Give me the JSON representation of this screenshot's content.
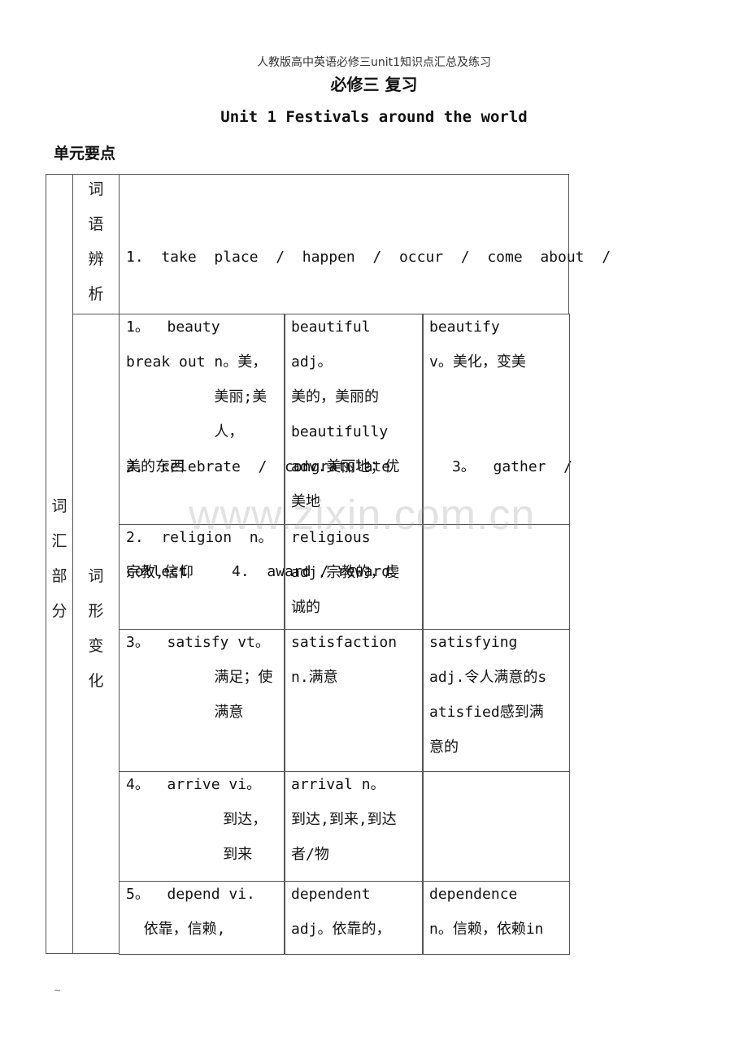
{
  "header": {
    "doc_name": "人教版高中英语必修三unit1知识点汇总及练习",
    "title": "必修三 复习",
    "unit_title": "Unit 1  Festivals around the world",
    "section": "单元要点"
  },
  "table": {
    "category": [
      "词",
      "汇",
      "部",
      "分"
    ],
    "word_discrimination": {
      "label": [
        "词",
        "语",
        "辨",
        "析"
      ],
      "lines": [
        "1.  take  place  /  happen  /  occur  /  come  about  /",
        "break out",
        "2.  celebrate  /  congratulate       3。  gather  /",
        "collect     4.  award / reward"
      ]
    },
    "word_forms": {
      "label": [
        "词",
        "形",
        "变",
        "化"
      ],
      "rows": [
        {
          "col1": [
            "1。  beauty",
            "          n。美，",
            "          美丽;美",
            "          人，",
            "美的东西"
          ],
          "col2": [
            "beautiful",
            "adj。",
            "美的，美丽的",
            "beautifully",
            "adv.美丽地；优",
            "美地"
          ],
          "col3": [
            "beautify",
            "v。美化，变美"
          ]
        },
        {
          "col1": [
            "2.  religion  n。",
            "宗教,信仰"
          ],
          "col2": [
            "religious",
            "adj.宗教的，虔",
            "诚的"
          ],
          "col3": []
        },
        {
          "col1": [
            "3。  satisfy vt。",
            "          满足；使",
            "          满意"
          ],
          "col2": [
            "satisfaction",
            "n.满意"
          ],
          "col3": [
            "satisfying",
            "adj.令人满意的s",
            "atisfied感到满",
            "意的"
          ]
        },
        {
          "col1": [
            "4。  arrive vi。",
            "           到达，",
            "           到来"
          ],
          "col2": [
            "arrival n。",
            "到达,到来,到达",
            "者/物"
          ],
          "col3": []
        },
        {
          "col1": [
            "5。  depend vi.",
            "  依靠，信赖,"
          ],
          "col2": [
            "dependent",
            "adj。依靠的，"
          ],
          "col3": [
            "dependence",
            "n。信赖，依赖in"
          ]
        }
      ]
    }
  },
  "watermark": "www.zixin.com.cn",
  "footer_mark": "~"
}
